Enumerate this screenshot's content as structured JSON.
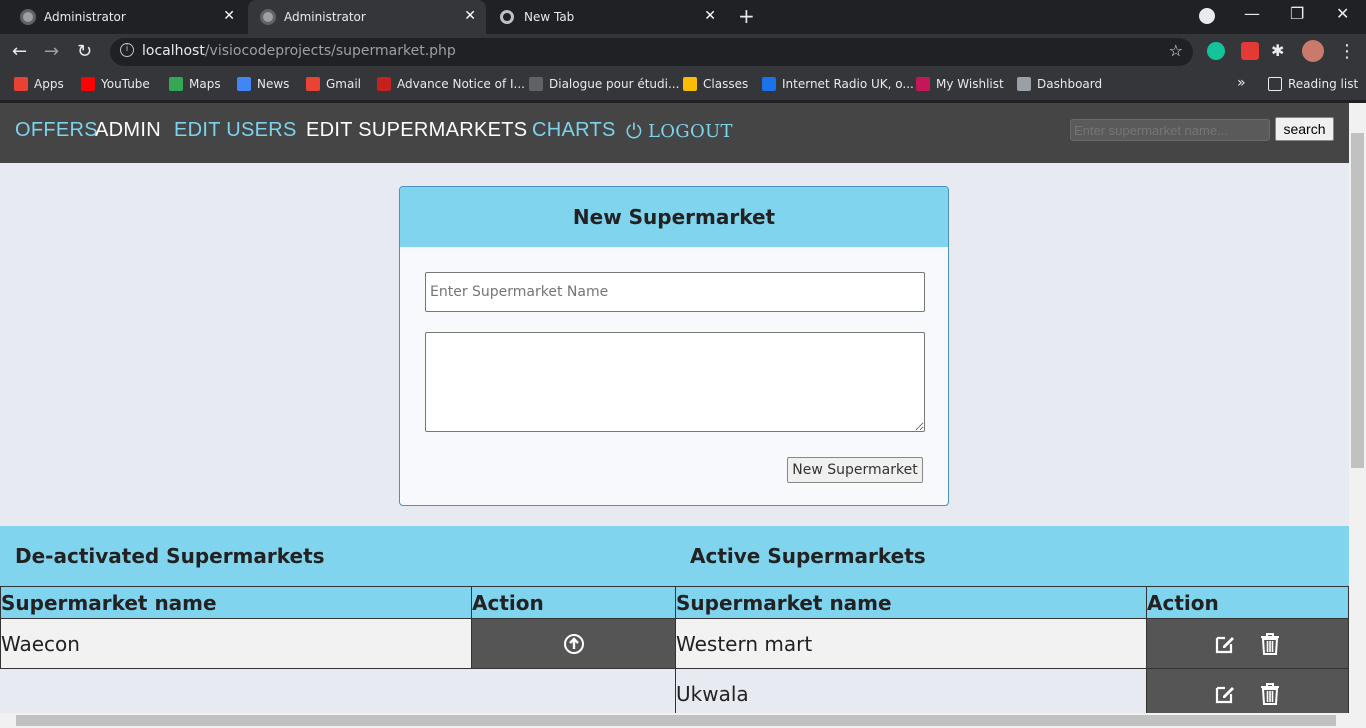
{
  "browser": {
    "tabs": [
      {
        "title": "Administrator"
      },
      {
        "title": "Administrator"
      },
      {
        "title": "New Tab"
      }
    ],
    "url_host": "localhost",
    "url_path": "/visiocodeprojects/supermarket.php",
    "bookmarks": [
      {
        "label": "Apps",
        "color": "#e94235"
      },
      {
        "label": "YouTube",
        "color": "#ff0000"
      },
      {
        "label": "Maps",
        "color": "#34a853"
      },
      {
        "label": "News",
        "color": "#4285f4"
      },
      {
        "label": "Gmail",
        "color": "#ea4335"
      },
      {
        "label": "Advance Notice of I...",
        "color": "#c5221f"
      },
      {
        "label": "Dialogue pour étudi...",
        "color": "#5f6368"
      },
      {
        "label": "Classes",
        "color": "#fbbc04"
      },
      {
        "label": "Internet Radio UK, o...",
        "color": "#1a73e8"
      },
      {
        "label": "My Wishlist",
        "color": "#c2185b"
      },
      {
        "label": "Dashboard",
        "color": "#9aa0a6"
      }
    ],
    "reading_list": "Reading list"
  },
  "nav": {
    "offers": "OFFERS",
    "admin": "ADMIN",
    "edit_users": "EDIT USERS",
    "edit_supermarkets": "EDIT SUPERMARKETS",
    "charts": "CHARTS",
    "logout": "LOGOUT",
    "search_placeholder": "Enter supermarket name...",
    "search_button": "search"
  },
  "form": {
    "title": "New Supermarket",
    "name_placeholder": "Enter Supermarket Name",
    "submit_label": "New Supermarket"
  },
  "deactivated": {
    "heading": "De-activated Supermarkets",
    "col_name": "Supermarket name",
    "col_action": "Action",
    "rows": [
      {
        "name": "Waecon"
      }
    ]
  },
  "active": {
    "heading": "Active Supermarkets",
    "col_name": "Supermarket name",
    "col_action": "Action",
    "rows": [
      {
        "name": "Western mart"
      },
      {
        "name": "Ukwala"
      }
    ]
  }
}
